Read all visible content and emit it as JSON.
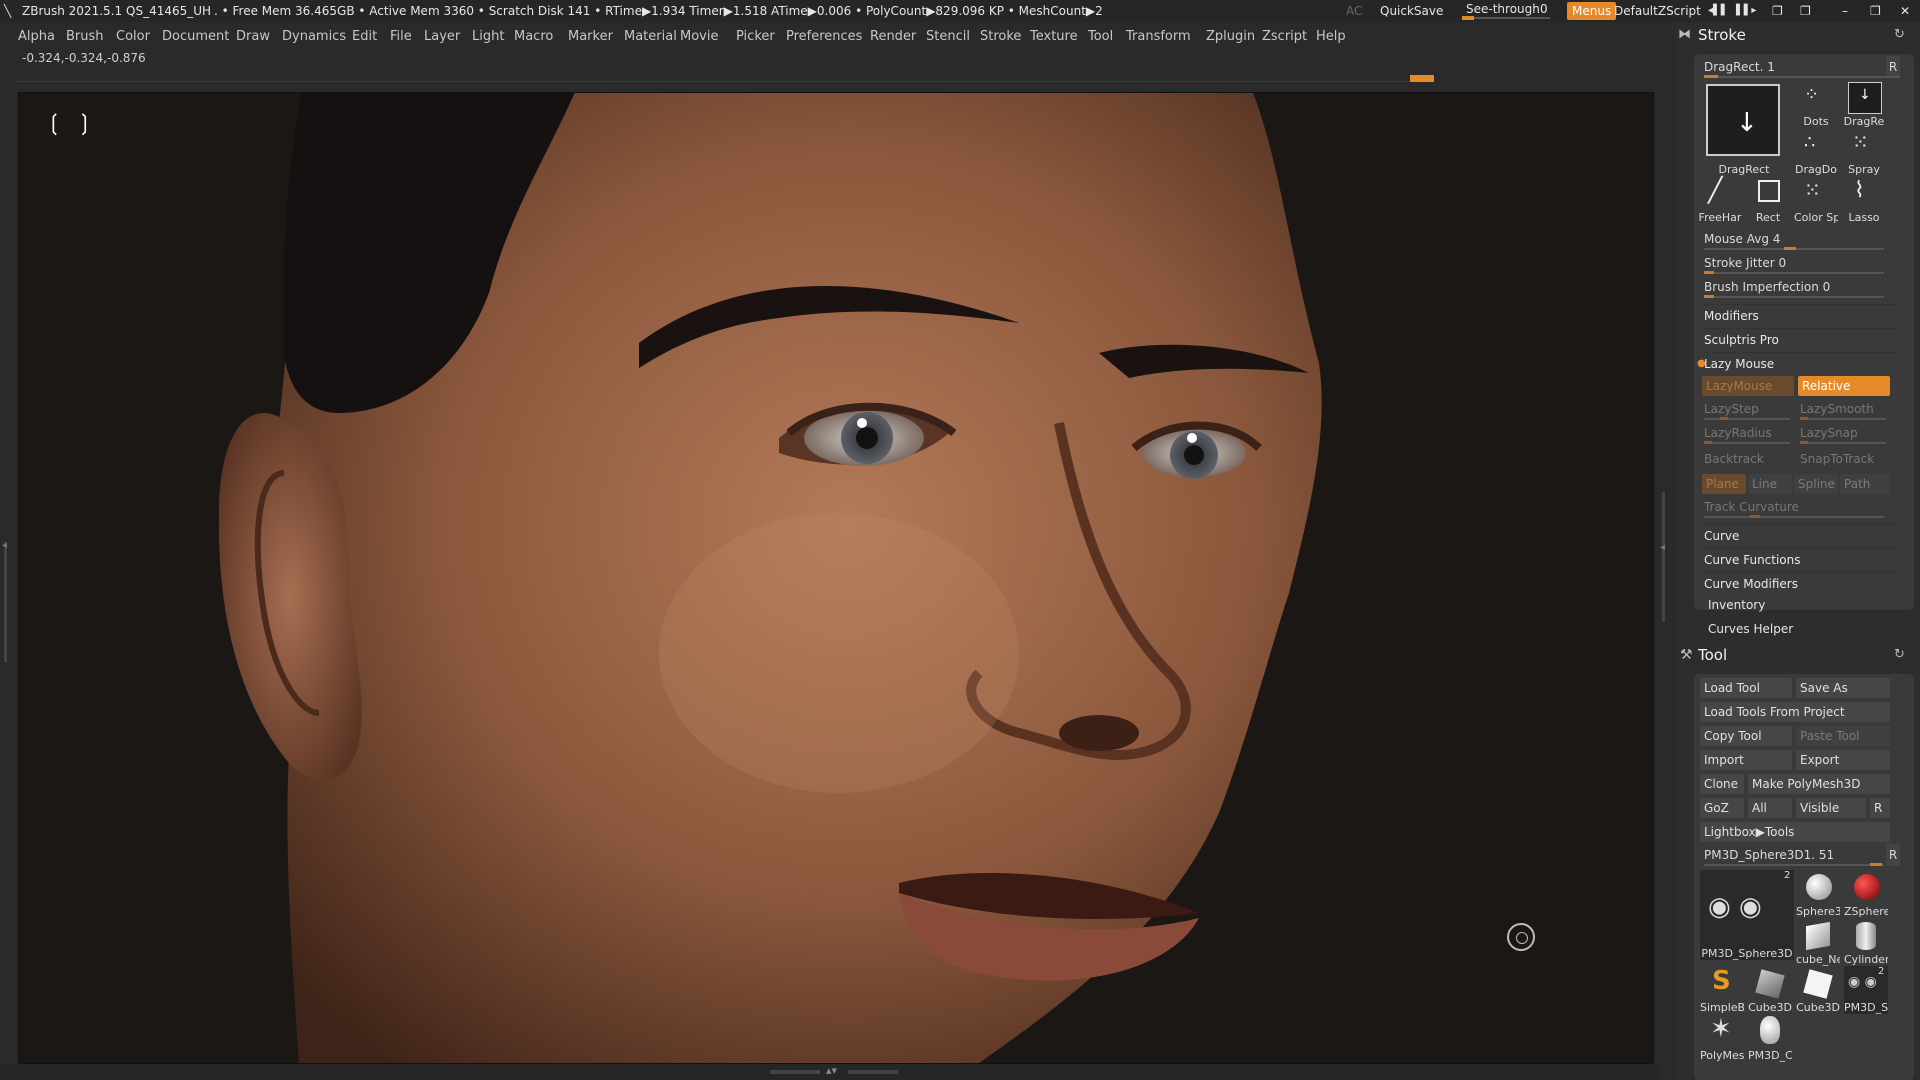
{
  "titlebar": {
    "app": "ZBrush 2021.5.1",
    "project": "QS_41465_UH",
    "stats": ". • Free Mem 36.465GB • Active Mem 3360 • Scratch Disk 141 •  RTime▶1.934 Timer▶1.518 ATime▶0.006 • PolyCount▶829.096 KP  • MeshCount▶2",
    "ac": "AC",
    "quicksave": "QuickSave",
    "seethrough": "See-through",
    "seethrough_value": "0",
    "menus": "Menus",
    "defaultzscript": "DefaultZScript"
  },
  "menubar": [
    "Alpha",
    "Brush",
    "Color",
    "Document",
    "Draw",
    "Dynamics",
    "Edit",
    "File",
    "Layer",
    "Light",
    "Macro",
    "Marker",
    "Material",
    "Movie",
    "Picker",
    "Preferences",
    "Render",
    "Stencil",
    "Stroke",
    "Texture",
    "Tool",
    "Transform",
    "Zplugin",
    "Zscript",
    "Help"
  ],
  "coords": "-0.324,-0.324,-0.876",
  "colors": {
    "accent": "#e58a28",
    "panel": "#3a3a3a",
    "bg": "#2a2a2a",
    "canvas": "#1a1715"
  },
  "stroke": {
    "title": "Stroke",
    "current": "DragRect. 1",
    "r": "R",
    "icons": [
      {
        "label": "DragRect",
        "icon": "dragrect-icon"
      },
      {
        "label": "Dots",
        "icon": "dots-icon"
      },
      {
        "label": "DragRe",
        "icon": "dragrect-small-icon"
      },
      {
        "label": "DragDo",
        "icon": "dragdot-icon"
      },
      {
        "label": "Spray",
        "icon": "spray-icon"
      },
      {
        "label": "FreeHar",
        "icon": "freehand-icon"
      },
      {
        "label": "Rect",
        "icon": "rect-icon"
      },
      {
        "label": "Color Sp",
        "icon": "color-spray-icon"
      },
      {
        "label": "Lasso",
        "icon": "lasso-icon"
      }
    ],
    "sliders": [
      {
        "label": "Mouse Avg 4",
        "value": 0.5
      },
      {
        "label": "Stroke Jitter 0",
        "value": 0.02
      },
      {
        "label": "Brush Imperfection 0",
        "value": 0.02
      }
    ],
    "sections1": [
      "Modifiers",
      "Sculptris Pro"
    ],
    "lazy": {
      "title": "Lazy Mouse",
      "lazymouse": "LazyMouse",
      "relative": "Relative",
      "lazystep": "LazyStep",
      "lazysmooth": "LazySmooth",
      "lazyradius": "LazyRadius",
      "lazysnap": "LazySnap",
      "backtrack": "Backtrack",
      "snaptotrack": "SnapToTrack",
      "modes": [
        "Plane",
        "Line",
        "Spline",
        "Path"
      ],
      "track": "Track Curvature"
    },
    "sections2": [
      "Curve",
      "Curve Functions",
      "Curve Modifiers"
    ]
  },
  "extra": [
    "Inventory",
    "Curves Helper"
  ],
  "tool": {
    "title": "Tool",
    "buttons": {
      "load": "Load Tool",
      "saveas": "Save As",
      "loadproject": "Load Tools From Project",
      "copy": "Copy Tool",
      "paste": "Paste Tool",
      "import": "Import",
      "export": "Export",
      "clone": "Clone",
      "makepoly": "Make PolyMesh3D",
      "goz": "GoZ",
      "all": "All",
      "visible": "Visible",
      "r": "R",
      "lightbox": "Lightbox▶Tools"
    },
    "current": "PM3D_Sphere3D1. 51",
    "current_r": "R",
    "current_count": "2",
    "thumbs": [
      {
        "label": "PM3D_Sphere3D",
        "icon": "eyes-mesh-icon"
      },
      {
        "label": "Sphere3",
        "icon": "sphere-icon"
      },
      {
        "label": "ZSphere",
        "icon": "zsphere-icon"
      },
      {
        "label": "cube_Ne",
        "icon": "cube-icon"
      },
      {
        "label": "Cylinder",
        "icon": "cylinder-icon"
      },
      {
        "label": "SimpleB",
        "icon": "simplebrush-icon"
      },
      {
        "label": "Cube3D",
        "icon": "cube3d-icon"
      },
      {
        "label": "Cube3D",
        "icon": "cube3d-white-icon"
      },
      {
        "label": "PM3D_S",
        "icon": "pm3d-eyes-icon",
        "badge": "2"
      },
      {
        "label": "PolyMes",
        "icon": "polymesh-star-icon"
      },
      {
        "label": "PM3D_C",
        "icon": "head-icon"
      }
    ]
  }
}
